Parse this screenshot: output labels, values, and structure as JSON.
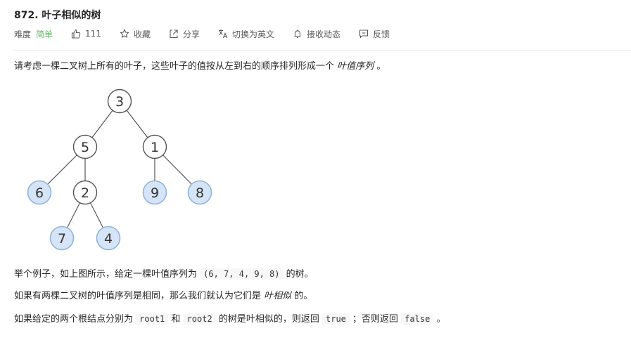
{
  "problem": {
    "title": "872. 叶子相似的树"
  },
  "meta": {
    "difficulty_label": "难度",
    "difficulty_value": "简单",
    "likes": "111",
    "favorite": "收藏",
    "share": "分享",
    "switch_lang": "切换为英文",
    "notify": "接收动态",
    "feedback": "反馈"
  },
  "intro": {
    "text": "请考虑一棵二叉树上所有的叶子，这些叶子的值按从左到右的顺序排列形成一个",
    "term": "叶值序列",
    "end": "。"
  },
  "tree": {
    "nodes": [
      "3",
      "5",
      "1",
      "6",
      "2",
      "9",
      "8",
      "7",
      "4"
    ],
    "leaves": [
      "6",
      "7",
      "4",
      "9",
      "8"
    ]
  },
  "example": {
    "prefix": "举个例子，如上图所示，给定一棵叶值序列为",
    "sequence": "(6, 7, 4, 9, 8)",
    "suffix": "的树。"
  },
  "similar": {
    "prefix": "如果有两棵二叉树的叶值序列是相同，那么我们就认为它们是",
    "term": "叶相似",
    "suffix": "的。"
  },
  "rule": {
    "p1": "如果给定的两个根结点分别为",
    "root1": "root1",
    "p2": "和",
    "root2": "root2",
    "p3": "的树是叶相似的，则返回",
    "true_val": "true",
    "p4": "；否则返回",
    "false_val": "false",
    "p5": "。"
  },
  "colors": {
    "leaf_fill": "#d6e4f7",
    "leaf_stroke": "#90b4dc",
    "node_stroke": "#555555",
    "easy_green": "#5cb85c"
  }
}
